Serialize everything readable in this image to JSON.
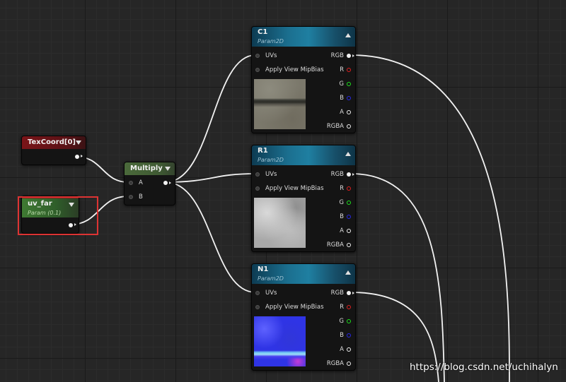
{
  "nodes": {
    "texcoord": {
      "title": "TexCoord[0]"
    },
    "uv_far": {
      "title": "uv_far",
      "subtitle": "Param (0.1)"
    },
    "multiply": {
      "title": "Multiply",
      "pins": {
        "a": "A",
        "b": "B"
      }
    },
    "c1": {
      "title": "C1",
      "subtitle": "Param2D",
      "texture": "stone-texture"
    },
    "r1": {
      "title": "R1",
      "subtitle": "Param2D",
      "texture": "grayscale-cloud-texture"
    },
    "n1": {
      "title": "N1",
      "subtitle": "Param2D",
      "texture": "normal-map-texture"
    }
  },
  "sampler_pins": {
    "inputs": [
      "UVs",
      "Apply View MipBias"
    ],
    "outputs": [
      "RGB",
      "R",
      "G",
      "B",
      "A",
      "RGBA"
    ]
  },
  "colors": {
    "pin_r": "#e21f1f",
    "pin_g": "#1ee01e",
    "pin_b": "#2727e8",
    "selection": "#dd3333",
    "param2d_header": "#1f7fa1",
    "texcoord_header": "#7a1418",
    "multiply_header": "#4b6a3b"
  },
  "watermark": "https://blog.csdn.net/uchihalyn"
}
